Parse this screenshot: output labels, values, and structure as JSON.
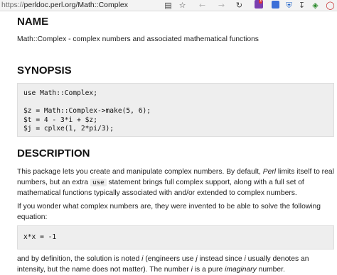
{
  "browser": {
    "url_prefix": "https://",
    "url_rest": "perldoc.perl.org/Math::Complex",
    "icons": [
      "reader-view-icon",
      "favorite-star-icon",
      "back-icon",
      "forward-icon",
      "reload-icon",
      "extension-icon",
      "extension-icon",
      "shield-icon",
      "download-icon",
      "extensions-puzzle-icon",
      "opera-icon",
      "notification-badge"
    ],
    "ext_badge_count": "1"
  },
  "name_section": {
    "heading": "NAME",
    "text": "Math::Complex - complex numbers and associated mathematical functions"
  },
  "synopsis": {
    "heading": "SYNOPSIS",
    "code_lines": [
      "use Math::Complex;",
      "",
      "$z = Math::Complex->make(5, 6);",
      "$t = 4 - 3*i + $z;",
      "$j = cplxe(1, 2*pi/3);"
    ]
  },
  "description": {
    "heading": "DESCRIPTION",
    "p1_a": "This package lets you create and manipulate complex numbers. By default, ",
    "p1_perl": "Perl",
    "p1_b": " limits itself to real numbers, but an extra ",
    "p1_use": "use",
    "p1_c": " statement brings full complex support, along with a full set of mathematical functions typically associated with and/or extended to complex numbers.",
    "p2": "If you wonder what complex numbers are, they were invented to be able to solve the following equation:",
    "equation": "x*x = -1",
    "p3_a": "and by definition, the solution is noted ",
    "p3_i1": "i",
    "p3_b": " (engineers use ",
    "p3_j": "j",
    "p3_c": " instead since ",
    "p3_i2": "i",
    "p3_d": " usually denotes an intensity, but the name does not matter). The number ",
    "p3_i3": "i",
    "p3_e": " is a pure ",
    "p3_imag": "imaginary",
    "p3_f": " number."
  }
}
